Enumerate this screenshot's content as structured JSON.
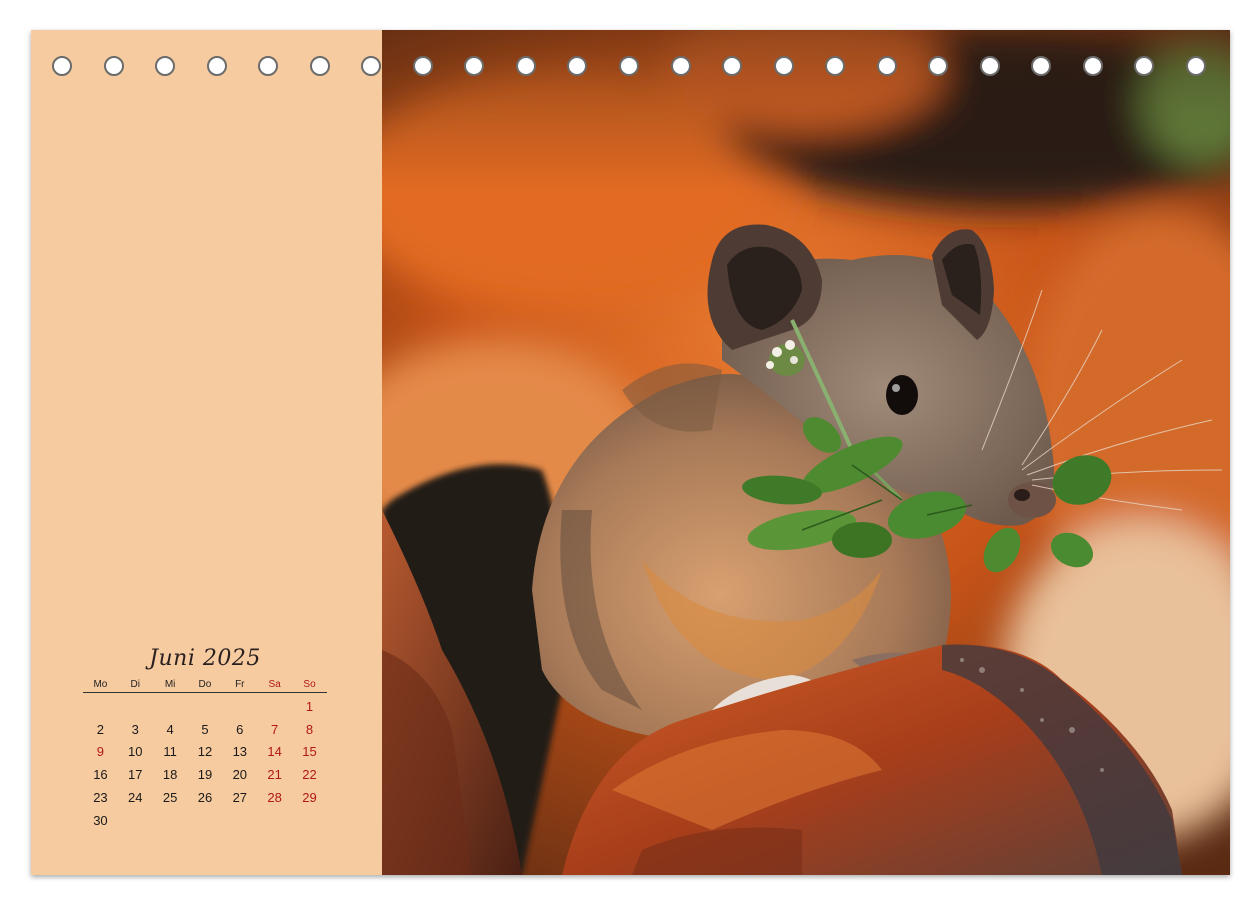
{
  "calendar": {
    "month_title": "Juni 2025",
    "weekdays": [
      {
        "label": "Mo",
        "weekend": false
      },
      {
        "label": "Di",
        "weekend": false
      },
      {
        "label": "Mi",
        "weekend": false
      },
      {
        "label": "Do",
        "weekend": false
      },
      {
        "label": "Fr",
        "weekend": false
      },
      {
        "label": "Sa",
        "weekend": true
      },
      {
        "label": "So",
        "weekend": true
      }
    ],
    "weeks": [
      [
        "",
        "",
        "",
        "",
        "",
        "",
        "1"
      ],
      [
        "2",
        "3",
        "4",
        "5",
        "6",
        "7",
        "8"
      ],
      [
        "9",
        "10",
        "11",
        "12",
        "13",
        "14",
        "15"
      ],
      [
        "16",
        "17",
        "18",
        "19",
        "20",
        "21",
        "22"
      ],
      [
        "23",
        "24",
        "25",
        "26",
        "27",
        "28",
        "29"
      ],
      [
        "30",
        "",
        "",
        "",
        "",
        "",
        ""
      ]
    ],
    "holiday_days": [
      "9"
    ]
  },
  "colors": {
    "panel": "#f7cba0",
    "weekend_text": "#b01818",
    "normal_text": "#1a1a1a"
  },
  "binding": {
    "hole_count": 23,
    "hole_icon": "ring-hole-icon"
  },
  "photo": {
    "subject_icon": "pika-photo"
  }
}
